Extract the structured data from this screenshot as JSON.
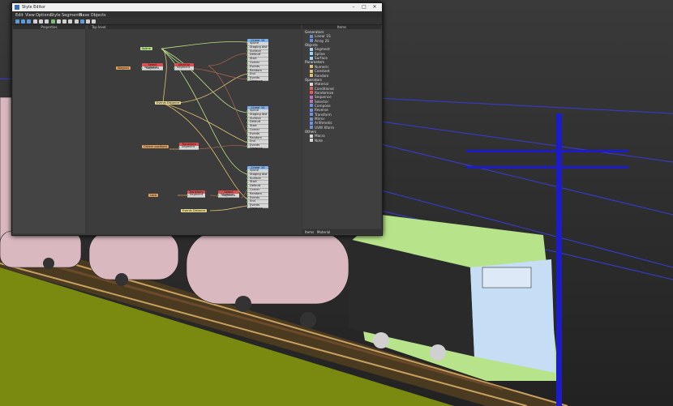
{
  "window": {
    "title": "Style Editor"
  },
  "menu": [
    "Edit",
    "View",
    "Options",
    "Style",
    "Segments",
    "Base Objects"
  ],
  "panels": {
    "properties": "Properties",
    "canvas": "Top level",
    "items": "Items"
  },
  "items": [
    {
      "label": "Generators",
      "category": true,
      "color": ""
    },
    {
      "label": "Linear 1S",
      "category": false,
      "color": "#6b8fd6"
    },
    {
      "label": "Array 2S",
      "category": false,
      "color": "#6b8fd6"
    },
    {
      "label": "Objects",
      "category": true,
      "color": ""
    },
    {
      "label": "Segment",
      "category": false,
      "color": "#9fd4f0"
    },
    {
      "label": "Spline",
      "category": false,
      "color": "#9fd4f0"
    },
    {
      "label": "Surface",
      "category": false,
      "color": "#9fd4f0"
    },
    {
      "label": "Parameters",
      "category": true,
      "color": ""
    },
    {
      "label": "Numeric",
      "category": false,
      "color": "#e0c080"
    },
    {
      "label": "Constant",
      "category": false,
      "color": "#e0c080"
    },
    {
      "label": "Random",
      "category": false,
      "color": "#e0c080"
    },
    {
      "label": "Operators",
      "category": true,
      "color": ""
    },
    {
      "label": "Material",
      "category": false,
      "color": "#d9d9d9"
    },
    {
      "label": "Conditional",
      "category": false,
      "color": "#e06060"
    },
    {
      "label": "Randomize",
      "category": false,
      "color": "#e06060"
    },
    {
      "label": "Sequence",
      "category": false,
      "color": "#c070c0"
    },
    {
      "label": "Selector",
      "category": false,
      "color": "#c070c0"
    },
    {
      "label": "Compose",
      "category": false,
      "color": "#7090e0"
    },
    {
      "label": "Reverse",
      "category": false,
      "color": "#7090e0"
    },
    {
      "label": "Transform",
      "category": false,
      "color": "#7090e0"
    },
    {
      "label": "Mirror",
      "category": false,
      "color": "#7090e0"
    },
    {
      "label": "Arithmetic",
      "category": false,
      "color": "#7090e0"
    },
    {
      "label": "UVW Xform",
      "category": false,
      "color": "#7090e0"
    },
    {
      "label": "Others",
      "category": true,
      "color": ""
    },
    {
      "label": "Macro",
      "category": false,
      "color": "#d9d9d9"
    },
    {
      "label": "Note",
      "category": false,
      "color": "#d9d9d9"
    }
  ],
  "bottom_tabs": [
    "Items",
    "Material"
  ],
  "nodes": {
    "linear1": {
      "title": "Linear 1S",
      "rows": [
        "Spline",
        "Staging dist",
        "Surface",
        "Default",
        "Start",
        "Corner",
        "Events",
        "Random",
        "End",
        "Events Distance"
      ]
    },
    "linear2": {
      "title": "Linear 1S",
      "rows": [
        "Spline",
        "Staging dist",
        "Surface",
        "Default",
        "Start",
        "Corner",
        "Events",
        "Random",
        "End",
        "Events Distance"
      ]
    },
    "linear3": {
      "title": "Linear 1S",
      "rows": [
        "Spline",
        "Staging dist",
        "Surface",
        "Start",
        "Default",
        "Corner",
        "Random",
        "Events",
        "End",
        "Events Distance"
      ]
    },
    "sel1": {
      "title": "Select Segment",
      "rows": [
        "Segment"
      ]
    },
    "sel2": {
      "title": "Selector",
      "rows": [
        "Segment"
      ]
    },
    "sel3": {
      "title": "Transform",
      "rows": [
        "Segment"
      ]
    },
    "sel4": {
      "title": "Transform",
      "rows": [
        "Segment"
      ]
    },
    "sel5": {
      "title": "Select Segment",
      "rows": [
        "Segment"
      ]
    }
  },
  "chips": {
    "spline": "Spline",
    "wagons": "Wagons",
    "events_dist1": "Events Distance",
    "events_dist2": "Events Distance",
    "events_dist3": "Events Distance",
    "loco": "Loco",
    "cisterns": "Cistern positions"
  }
}
